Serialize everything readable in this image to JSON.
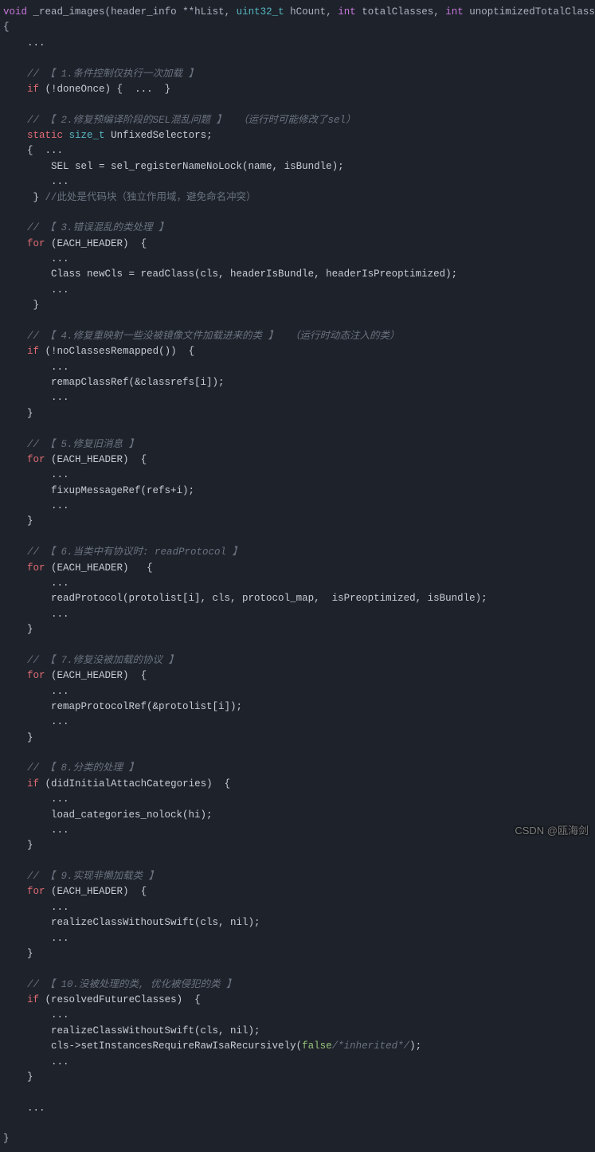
{
  "sig": {
    "ret": "void",
    "name": "_read_images",
    "p1t": "header_info",
    "p1s": "**",
    "p1n": "hList",
    "p2t": "uint32_t",
    "p2n": "hCount",
    "p3t": "int",
    "p3n": "totalClasses",
    "p4t": "int",
    "p4n": "unoptimizedTotalClasses"
  },
  "ellipsis": "...",
  "c1": "// 【 1.条件控制仅执行一次加载 】",
  "l1_if": "if",
  "l1_cond": "(!doneOnce) {  ...  }",
  "c2a": "// 【 2.修复预编译阶段的SEL混乱问题 】",
  "c2b": "（运行时可能修改了sel）",
  "l2_static": "static",
  "l2_sizet": "size_t",
  "l2_var": "UnfixedSelectors;",
  "l2_open": "{  ...",
  "l2_body": "SEL sel = sel_registerNameNoLock(name, isBundle);",
  "l2_close": " } ",
  "l2_cmt": "//此处是代码块（独立作用域，避免命名冲突）",
  "c3": "// 【 3.错误混乱的类处理 】",
  "for_kw": "for",
  "each_hdr": "(EACH_HEADER)  {",
  "each_hdr2": "(EACH_HEADER)   {",
  "l3_body": "Class newCls = readClass(cls, headerIsBundle, headerIsPreoptimized);",
  "close_brace": " }",
  "close_brace2": "}",
  "c4a": "// 【 4.修复重映射一些没被镜像文件加载进来的类 】",
  "c4b": "（运行时动态注入的类）",
  "l4_cond": "(!noClassesRemapped())  {",
  "l4_body": "remapClassRef(&classrefs[i]);",
  "c5": "// 【 5.修复旧消息 】",
  "l5_body": "fixupMessageRef(refs+i);",
  "c6a": "// 【 6.当类中有协议时: ",
  "c6b": "readProtocol",
  "c6c": " 】",
  "l6_body": "readProtocol(protolist[i], cls, protocol_map,  isPreoptimized, isBundle);",
  "c7": "// 【 7.修复没被加载的协议 】",
  "l7_body": "remapProtocolRef(&protolist[i]);",
  "c8": "// 【 8.分类的处理 】",
  "l8_cond": "(didInitialAttachCategories)  {",
  "l8_body": "load_categories_nolock(hi);",
  "c9": "// 【 9.实现非懒加载类 】",
  "l9_body": "realizeClassWithoutSwift(cls, nil);",
  "c10": "// 【 10.没被处理的类, 优化被侵犯的类 】",
  "l10_cond": "(resolvedFutureClasses)  {",
  "l10_body1": "realizeClassWithoutSwift(cls, nil);",
  "l10_body2a": "cls->setInstancesRequireRawIsaRecursively(",
  "l10_false": "false",
  "l10_body2b": "/*inherited*/",
  "l10_body2c": ");",
  "open_brace": "{",
  "final_close": "}",
  "watermark": "CSDN @瓯海剑"
}
